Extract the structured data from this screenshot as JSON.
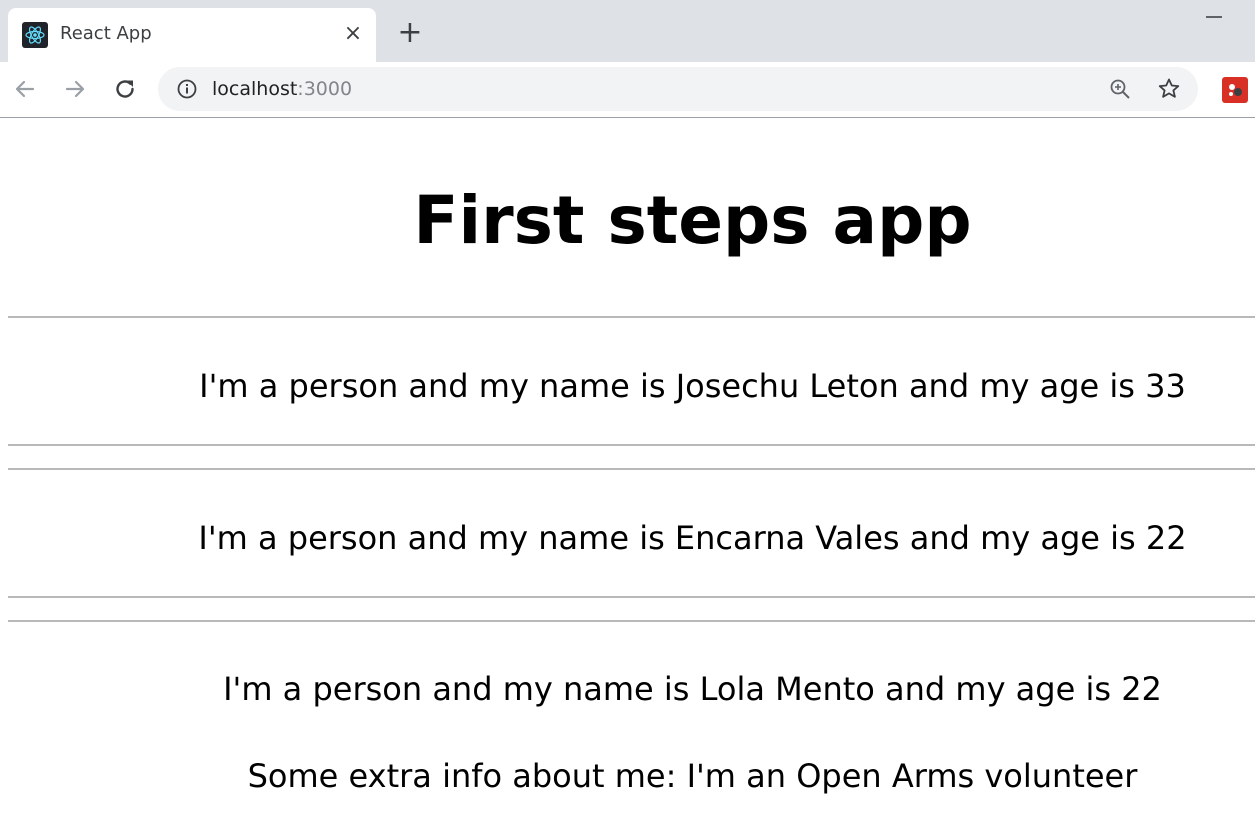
{
  "browser": {
    "tab_title": "React App",
    "tab_close": "×",
    "new_tab": "+",
    "url_host": "localhost",
    "url_port": ":3000"
  },
  "page": {
    "title": "First steps app",
    "persons": [
      {
        "text": "I'm a person and my name is Josechu Leton and my age is 33"
      },
      {
        "text": "I'm a person and my name is Encarna Vales and my age is 22"
      },
      {
        "text": "I'm a person and my name is Lola Mento and my age is 22",
        "extra": "Some extra info about me: I'm an Open Arms volunteer"
      }
    ]
  }
}
